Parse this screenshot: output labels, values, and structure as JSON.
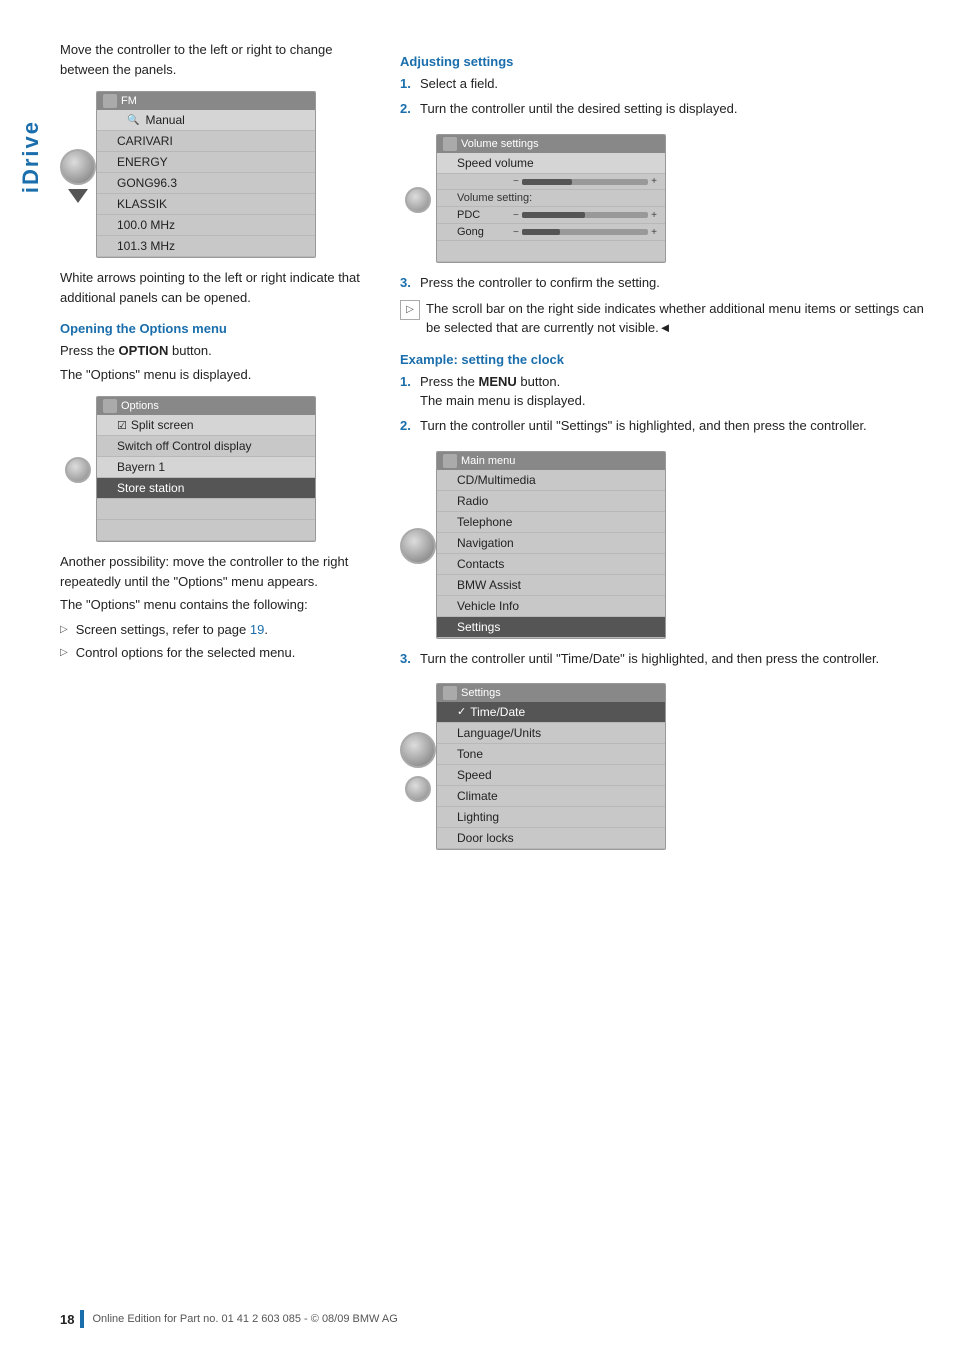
{
  "sidebar": {
    "label": "iDrive"
  },
  "left_col": {
    "intro_text": "Move the controller to the left or right to change between the panels.",
    "fm_screen": {
      "title": "FM",
      "rows": [
        {
          "text": "Manual",
          "type": "light"
        },
        {
          "text": "CARIVARI",
          "type": "normal"
        },
        {
          "text": "ENERGY",
          "type": "normal"
        },
        {
          "text": "GONG96.3",
          "type": "normal"
        },
        {
          "text": "KLASSIK",
          "type": "normal"
        },
        {
          "text": "100.0 MHz",
          "type": "normal"
        },
        {
          "text": "101.3 MHz",
          "type": "normal"
        }
      ]
    },
    "white_arrows_text": "White arrows pointing to the left or right indicate that additional panels can be opened.",
    "options_section": {
      "heading": "Opening the Options menu",
      "para1": "Press the OPTION button.",
      "para1_bold": "OPTION",
      "para2": "The \"Options\" menu is displayed.",
      "options_screen": {
        "title": "Options",
        "rows": [
          {
            "text": "Split screen",
            "type": "check",
            "check": true
          },
          {
            "text": "Switch off Control display",
            "type": "normal"
          },
          {
            "text": "Bayern 1",
            "type": "normal"
          },
          {
            "text": "Store station",
            "type": "highlighted"
          }
        ]
      },
      "another_pos_text": "Another possibility: move the controller to the right repeatedly until the \"Options\" menu appears.",
      "contains_text": "The \"Options\" menu contains the following:",
      "bullets": [
        {
          "text": "Screen settings, refer to page 19."
        },
        {
          "text": "Control options for the selected menu."
        }
      ],
      "page_link": "19"
    }
  },
  "right_col": {
    "adjusting_section": {
      "heading": "Adjusting settings",
      "steps": [
        {
          "num": "1.",
          "text": "Select a field."
        },
        {
          "num": "2.",
          "text": "Turn the controller until the desired setting is displayed."
        }
      ],
      "vol_screen": {
        "title": "Volume settings",
        "speed_volume_label": "Speed volume",
        "sliders": [
          {
            "label": "",
            "fill": 40
          },
          {
            "label": "Volume setting:",
            "fill": 0
          }
        ],
        "rows": [
          {
            "label": "PDC",
            "fill": 50
          },
          {
            "label": "Gong",
            "fill": 30
          }
        ]
      },
      "step3": "Press the controller to confirm the setting.",
      "scroll_note": "The scroll bar on the right side indicates whether additional menu items or settings can be selected that are currently not visible.◄"
    },
    "clock_section": {
      "heading": "Example: setting the clock",
      "steps": [
        {
          "num": "1.",
          "text1": "Press the ",
          "bold": "MENU",
          "text2": " button.",
          "sub": "The main menu is displayed."
        },
        {
          "num": "2.",
          "text1": "Turn the controller until \"Settings\" is highlighted, and then press the controller."
        }
      ],
      "main_menu_screen": {
        "title": "Main menu",
        "rows": [
          {
            "text": "CD/Multimedia",
            "type": "normal"
          },
          {
            "text": "Radio",
            "type": "normal"
          },
          {
            "text": "Telephone",
            "type": "normal"
          },
          {
            "text": "Navigation",
            "type": "normal"
          },
          {
            "text": "Contacts",
            "type": "normal"
          },
          {
            "text": "BMW Assist",
            "type": "normal"
          },
          {
            "text": "Vehicle Info",
            "type": "normal"
          },
          {
            "text": "Settings",
            "type": "highlighted"
          }
        ]
      },
      "step3_text": "Turn the controller until \"Time/Date\" is highlighted, and then press the controller.",
      "settings_screen": {
        "title": "Settings",
        "rows": [
          {
            "text": "Time/Date",
            "type": "highlighted",
            "check": true
          },
          {
            "text": "Language/Units",
            "type": "normal"
          },
          {
            "text": "Tone",
            "type": "normal"
          },
          {
            "text": "Speed",
            "type": "normal"
          },
          {
            "text": "Climate",
            "type": "normal"
          },
          {
            "text": "Lighting",
            "type": "normal"
          },
          {
            "text": "Door locks",
            "type": "normal"
          }
        ]
      }
    }
  },
  "footer": {
    "page_number": "18",
    "text": "Online Edition for Part no. 01 41 2 603 085 - © 08/09 BMW AG"
  }
}
